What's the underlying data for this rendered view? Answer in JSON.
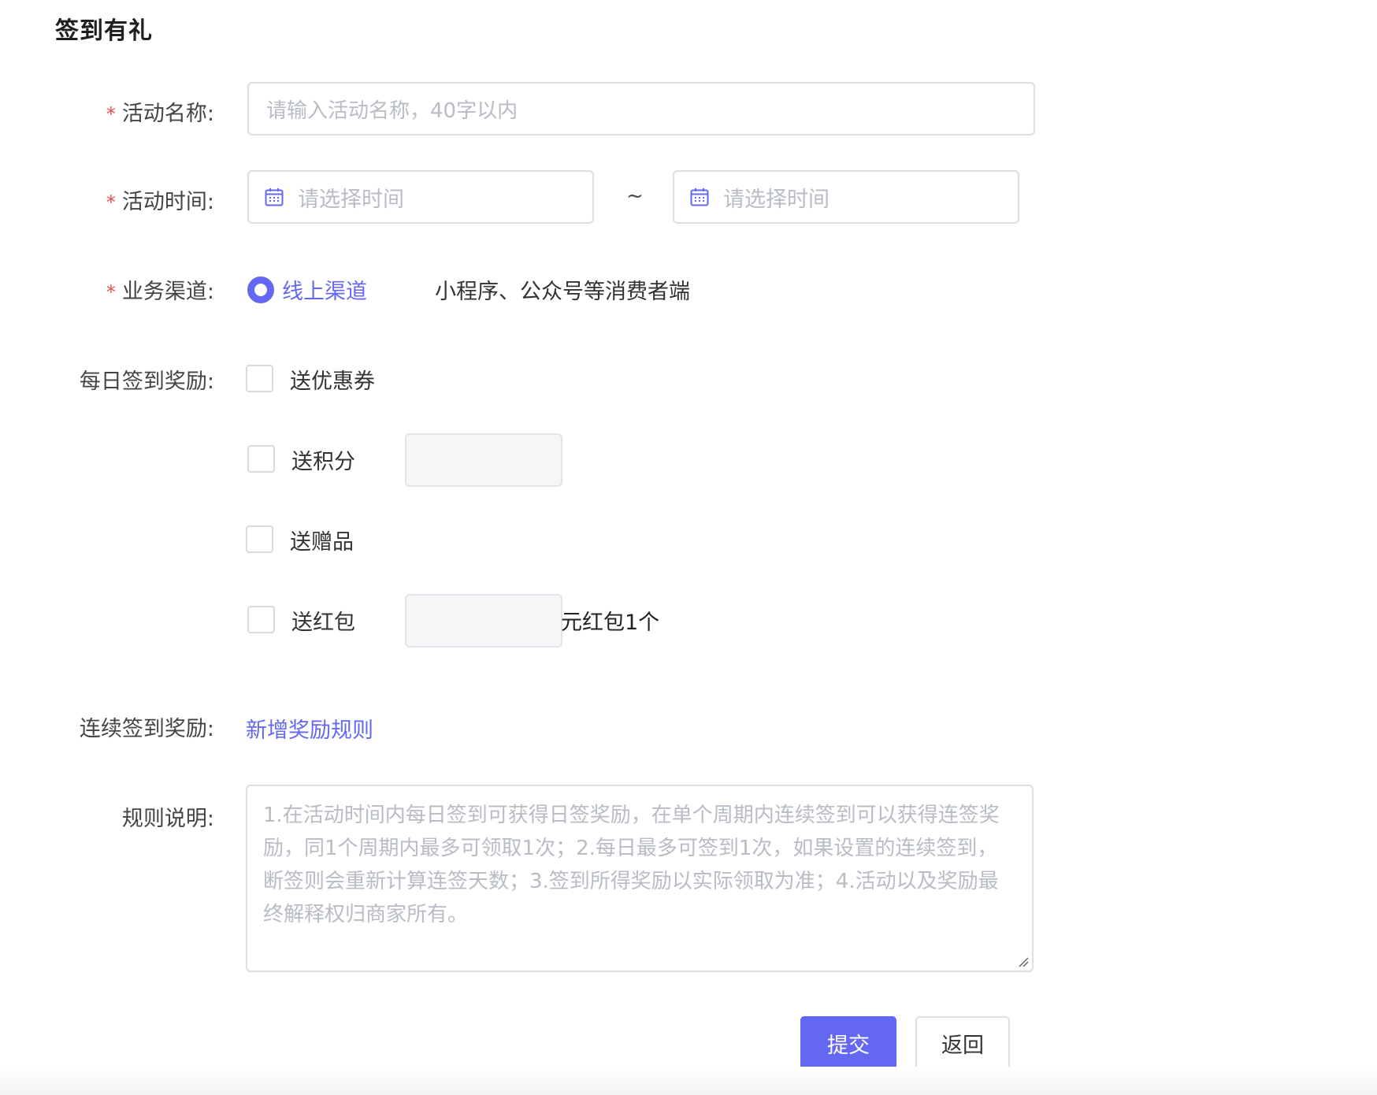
{
  "page": {
    "title": "签到有礼"
  },
  "form": {
    "activity_name": {
      "label": "活动名称:",
      "required_mark": "*",
      "placeholder": "请输入活动名称，40字以内",
      "value": ""
    },
    "activity_time": {
      "label": "活动时间:",
      "required_mark": "*",
      "start_placeholder": "请选择时间",
      "end_placeholder": "请选择时间",
      "separator": "~",
      "icon": "calendar-icon"
    },
    "channel": {
      "label": "业务渠道:",
      "required_mark": "*",
      "option_label": "线上渠道",
      "selected": true,
      "help_text": "小程序、公众号等消费者端"
    },
    "daily_reward": {
      "label": "每日签到奖励:",
      "options": {
        "coupon": {
          "label": "送优惠券",
          "checked": false
        },
        "points": {
          "label": "送积分",
          "checked": false,
          "value": ""
        },
        "gift": {
          "label": "送赠品",
          "checked": false
        },
        "red_packet": {
          "label": "送红包",
          "checked": false,
          "value": "",
          "suffix": "元红包1个"
        }
      }
    },
    "continuous_reward": {
      "label": "连续签到奖励:",
      "link_text": "新增奖励规则"
    },
    "rules": {
      "label": "规则说明:",
      "placeholder": "1.在活动时间内每日签到可获得日签奖励，在单个周期内连续签到可以获得连签奖励，同1个周期内最多可领取1次；2.每日最多可签到1次，如果设置的连续签到，断签则会重新计算连签天数；3.签到所得奖励以实际领取为准；4.活动以及奖励最终解释权归商家所有。"
    }
  },
  "actions": {
    "submit_label": "提交",
    "back_label": "返回"
  },
  "colors": {
    "accent": "#6467f2",
    "required": "#e0504a",
    "border": "#dcdfe6",
    "placeholder": "#b8bcc4"
  }
}
